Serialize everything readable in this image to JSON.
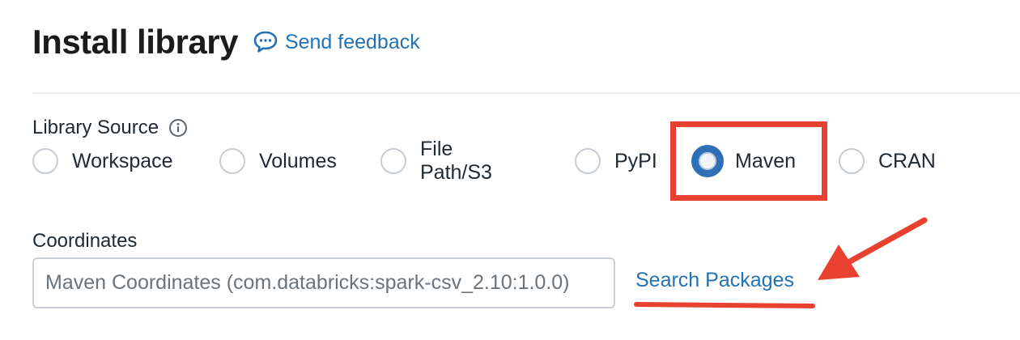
{
  "header": {
    "title": "Install library",
    "feedback_label": "Send feedback"
  },
  "library_source": {
    "label": "Library Source",
    "options": [
      {
        "label": "Workspace",
        "selected": false
      },
      {
        "label": "Volumes",
        "selected": false
      },
      {
        "label": "File Path/S3",
        "selected": false
      },
      {
        "label": "PyPI",
        "selected": false
      },
      {
        "label": "Maven",
        "selected": true
      },
      {
        "label": "CRAN",
        "selected": false
      }
    ]
  },
  "coordinates": {
    "label": "Coordinates",
    "placeholder": "Maven Coordinates (com.databricks:spark-csv_2.10:1.0.0)",
    "value": ""
  },
  "search_packages_label": "Search Packages",
  "colors": {
    "accent": "#2272b4",
    "annotation": "#e8412f",
    "radio_selected": "#2f6fb5"
  }
}
